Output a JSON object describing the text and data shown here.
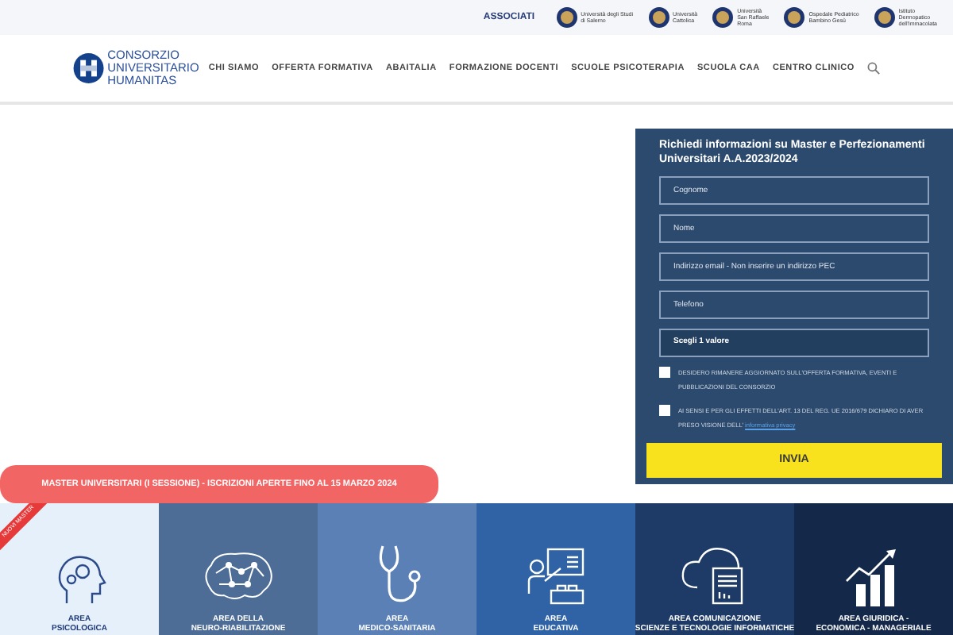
{
  "topbar": {
    "label": "ASSOCIATI",
    "partners": [
      {
        "line1": "Università degli Studi",
        "line2": "di Salerno"
      },
      {
        "line1": "Università",
        "line2": "Cattolica"
      },
      {
        "line1": "Università",
        "line2": "San Raffaele",
        "line3": "Roma"
      },
      {
        "line1": "Ospedale Pediatrico",
        "line2": "Bambino Gesù"
      },
      {
        "line1": "Istituto",
        "line2": "Dermopatico",
        "line3": "dell'Immacolata"
      }
    ]
  },
  "logo": {
    "lines": [
      "CONSORZIO",
      "UNIVERSITARIO",
      "HUMANITAS"
    ]
  },
  "nav": [
    "CHI SIAMO",
    "OFFERTA FORMATIVA",
    "ABAITALIA",
    "FORMAZIONE DOCENTI",
    "SCUOLE PSICOTERAPIA",
    "SCUOLA CAA",
    "CENTRO CLINICO"
  ],
  "form": {
    "title": "Richiedi informazioni su Master e Perfezionamenti Universitari A.A.2023/2024",
    "fields": [
      {
        "kind": "input",
        "placeholder": "Cognome"
      },
      {
        "kind": "input",
        "placeholder": "Nome"
      },
      {
        "kind": "input",
        "placeholder": "Indirizzo email - Non inserire un indirizzo PEC"
      },
      {
        "kind": "input",
        "placeholder": "Telefono"
      },
      {
        "kind": "select",
        "value": "Scegli 1 valore"
      }
    ],
    "consents": [
      {
        "text": "DESIDERO RIMANERE AGGIORNATO SULL'OFFERTA FORMATIVA, EVENTI E PUBBLICAZIONI DEL CONSORZIO",
        "checked": false
      },
      {
        "text": "AI SENSI E PER GLI EFFETTI DELL'ART. 13 DEL REG. UE 2016/679 DICHIARO DI AVER PRESO VISIONE DELL'",
        "link": "informativa privacy",
        "checked": false
      }
    ],
    "submit": "INVIA"
  },
  "banner": "MASTER UNIVERSITARI (I SESSIONE) - ISCRIZIONI APERTE FINO AL 15 MARZO 2024",
  "areas": [
    {
      "kind": "head",
      "lines": [
        "AREA",
        "PSICOLOGICA"
      ],
      "color": "#e6f0fa",
      "ribbon": "NUOVI MASTER"
    },
    {
      "kind": "brain",
      "lines": [
        "AREA DELLA",
        "NEURO-RIABILITAZIONE"
      ],
      "color": "#4d6d96"
    },
    {
      "kind": "stethoscope",
      "lines": [
        "AREA",
        "MEDICO-SANITARIA"
      ],
      "color": "#5b80b5"
    },
    {
      "kind": "teacher",
      "lines": [
        "AREA",
        "EDUCATIVA"
      ],
      "color": "#2f63a6"
    },
    {
      "kind": "cloud",
      "lines": [
        "AREA COMUNICAZIONE",
        "SCIENZE E TECNOLOGIE INFORMATICHE"
      ],
      "color": "#1e3a66"
    },
    {
      "kind": "chart",
      "lines": [
        "AREA GIURIDICA -",
        "ECONOMICA - MANAGERIALE"
      ],
      "color": "#14294a"
    }
  ]
}
